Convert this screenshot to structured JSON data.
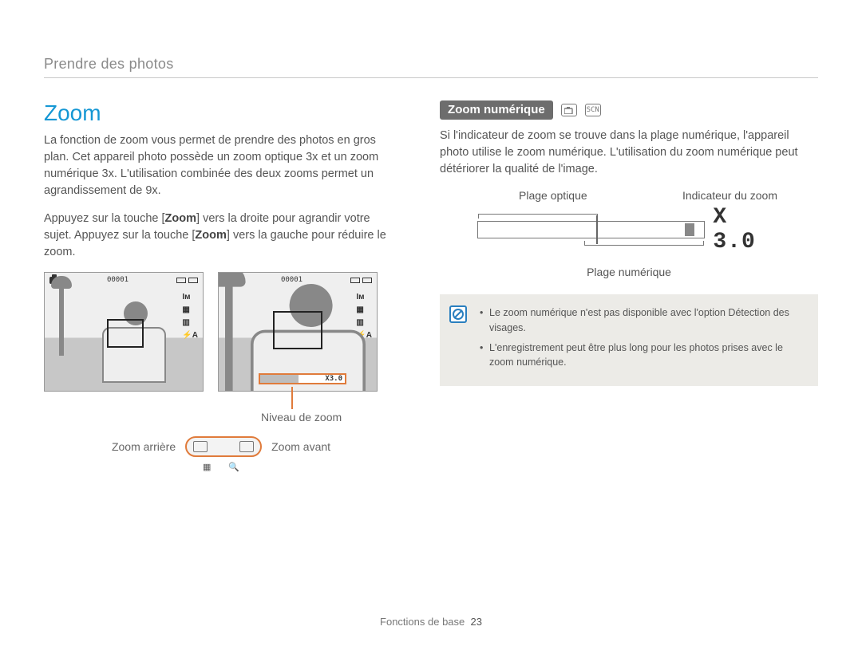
{
  "breadcrumb": "Prendre des photos",
  "section_title": "Zoom",
  "para1": "La fonction de zoom vous permet de prendre des photos en gros plan. Cet appareil photo possède un zoom optique 3x et un zoom numérique 3x. L'utilisation combinée des deux zooms permet un agrandissement de 9x.",
  "para2_a": "Appuyez sur la touche [",
  "para2_zoom1": "Zoom",
  "para2_b": "] vers la droite pour agrandir votre sujet. Appuyez sur la touche [",
  "para2_zoom2": "Zoom",
  "para2_c": "] vers la gauche pour réduire le zoom.",
  "shot_counter": "00001",
  "side_icons": {
    "res": "Iм",
    "quality": "▦",
    "meter": "▥",
    "flash": "⚡A"
  },
  "zoom_strip_value": "X3.0",
  "callout_label": "Niveau de zoom",
  "rocker": {
    "left": "Zoom arrière",
    "right": "Zoom avant"
  },
  "sub_icons": {
    "grid": "▦",
    "mag": "🔍"
  },
  "sub_header": "Zoom numérique",
  "right_para": "Si l'indicateur de zoom se trouve dans la plage numérique, l'appareil photo utilise le zoom numérique. L'utilisation du zoom numérique peut détériorer la qualité de l'image.",
  "diagram": {
    "optical": "Plage optique",
    "indicator": "Indicateur du zoom",
    "digital": "Plage numérique",
    "value": "X 3.0"
  },
  "info": {
    "item1": "Le zoom numérique n'est pas disponible avec l'option Détection des visages.",
    "item2": "L'enregistrement peut être plus long pour les photos prises avec le zoom numérique."
  },
  "footer": {
    "section": "Fonctions de base",
    "page": "23"
  }
}
